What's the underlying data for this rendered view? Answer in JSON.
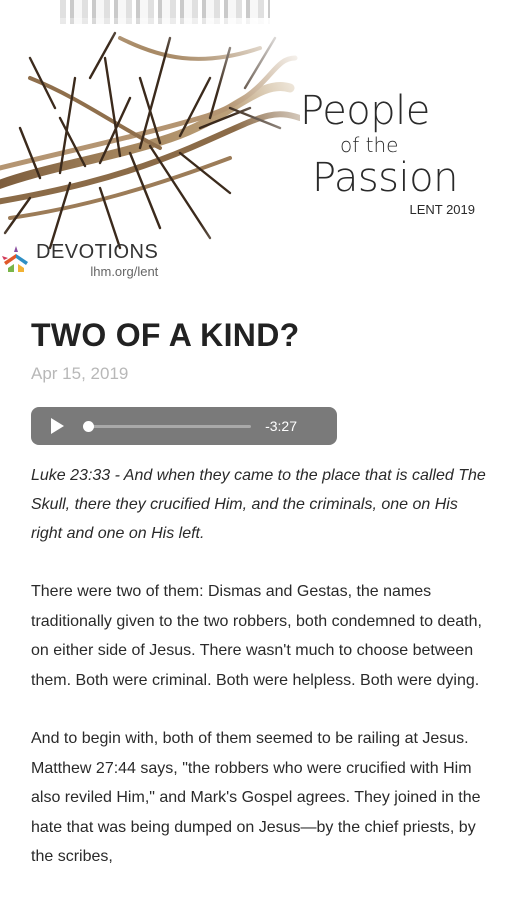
{
  "header": {
    "title_line1": "People",
    "title_line2": "of the",
    "title_line3": "Passion",
    "subtitle": "LENT 2019",
    "devotions_label": "DEVOTIONS",
    "devotions_url": "lhm.org/lent",
    "image_icon": "crown-of-thorns-image",
    "logo_icon": "lhm-logo-icon"
  },
  "article": {
    "title": "TWO OF A KIND?",
    "date": "Apr 15, 2019",
    "audio": {
      "time_remaining": "-3:27",
      "progress": 0.0
    },
    "verse": "Luke 23:33 - And when they came to the place that is called The Skull, there they crucified Him, and the criminals, one on His right and one on His left.",
    "paragraphs": [
      "There were two of them: Dismas and Gestas, the names traditionally given to the two robbers, both condemned to death, on either side of Jesus. There wasn't much to choose between them. Both were criminal. Both were helpless. Both were dying.",
      "And to begin with, both of them seemed to be railing at Jesus. Matthew 27:44 says, \"the robbers who were crucified with Him also reviled Him,\" and Mark's Gospel agrees. They joined in the hate that was being dumped on Jesus—by the chief priests, by the scribes,"
    ]
  },
  "colors": {
    "player_bg": "#7a7a7a",
    "date_text": "#b8b8b8",
    "body_text": "#2a2a2a"
  }
}
